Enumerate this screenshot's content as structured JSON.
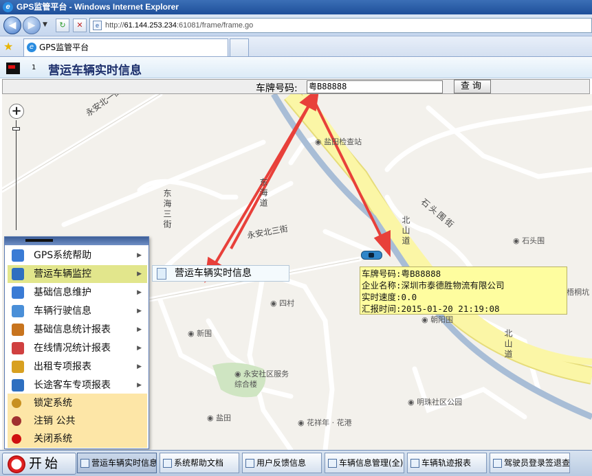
{
  "window": {
    "title": "GPS监管平台 - Windows Internet Explorer"
  },
  "browser": {
    "url_gray": "http://",
    "url_host": "61.144.253.234",
    "url_rest": ":61081/frame/frame.go",
    "tab_label": "GPS监管平台"
  },
  "page": {
    "number": "1",
    "title": "营运车辆实时信息",
    "plate_label": "车牌号码:",
    "plate_value": "粤B88888",
    "query_button": "查询"
  },
  "map": {
    "labels": [
      {
        "text": "永安北一街",
        "id": "label-yonganbei1"
      },
      {
        "text": "盐田检查站",
        "id": "label-jianchazhan"
      },
      {
        "text": "东海道",
        "id": "label-donghaidao"
      },
      {
        "text": "东海三街",
        "id": "label-donghai3"
      },
      {
        "text": "永安北三街",
        "id": "label-yonganbei3"
      },
      {
        "text": "石头围街",
        "id": "label-shitouwei"
      },
      {
        "text": "北山道",
        "id": "label-beishandao"
      },
      {
        "text": "石头围",
        "id": "label-shitouwei-poi"
      },
      {
        "text": "四村",
        "id": "label-sicun"
      },
      {
        "text": "朝阳围",
        "id": "label-chaoyangwei"
      },
      {
        "text": "新围",
        "id": "label-xinwei"
      },
      {
        "text": "永安社区服务综合楼",
        "id": "label-yongan-service"
      },
      {
        "text": "明珠社区公园",
        "id": "label-mingzhu-park"
      },
      {
        "text": "盐田",
        "id": "label-yantian"
      },
      {
        "text": "花祥年 · 花港",
        "id": "label-huaxiang"
      },
      {
        "text": "梧桐坑",
        "id": "label-wutongkeng"
      }
    ],
    "info": {
      "plate": "车牌号码:粤B88888",
      "company": "企业名称:深圳市泰德胜物流有限公司",
      "speed": "实时速度:0.0",
      "report_time": "汇报时间:2015-01-20 21:19:08"
    }
  },
  "start_menu": {
    "items": [
      {
        "label": "GPS系统帮助",
        "icon": "help-icon",
        "color": "#3a7bd5",
        "arrow": true
      },
      {
        "label": "营运车辆监控",
        "icon": "monitor-icon",
        "color": "#2e6fc0",
        "arrow": true
      },
      {
        "label": "基础信息维护",
        "icon": "maintenance-icon",
        "color": "#3a7bd5",
        "arrow": true
      },
      {
        "label": "车辆行驶信息",
        "icon": "car-icon",
        "color": "#4a8fd8",
        "arrow": true
      },
      {
        "label": "基础信息统计报表",
        "icon": "box-icon",
        "color": "#c8741e",
        "arrow": true
      },
      {
        "label": "在线情况统计报表",
        "icon": "chart-icon",
        "color": "#d04040",
        "arrow": true
      },
      {
        "label": "出租专项报表",
        "icon": "taxi-icon",
        "color": "#d8a020",
        "arrow": true
      },
      {
        "label": "长途客车专项报表",
        "icon": "bus-icon",
        "color": "#2e6fc0",
        "arrow": true
      }
    ],
    "lower": [
      {
        "label": "锁定系统",
        "icon": "lock-icon",
        "color": "#c89020"
      },
      {
        "label": "注销 公共",
        "icon": "key-icon",
        "color": "#a03030"
      },
      {
        "label": "关闭系统",
        "icon": "power-icon",
        "color": "#d01010"
      }
    ],
    "submenu_item": "营运车辆实时信息"
  },
  "taskbar": {
    "start_label": "开始",
    "buttons": [
      {
        "label": "营运车辆实时信息",
        "active": true
      },
      {
        "label": "系统帮助文档",
        "active": false
      },
      {
        "label": "用户反馈信息",
        "active": false
      },
      {
        "label": "车辆信息管理(全)",
        "active": false
      },
      {
        "label": "车辆轨迹报表",
        "active": false
      },
      {
        "label": "驾驶员登录签退查",
        "active": false
      }
    ]
  },
  "colors": {
    "road_main": "#fbf6a6",
    "river": "#a8bdd6",
    "arrow": "#e8403a",
    "infobox": "#fefd9f"
  }
}
